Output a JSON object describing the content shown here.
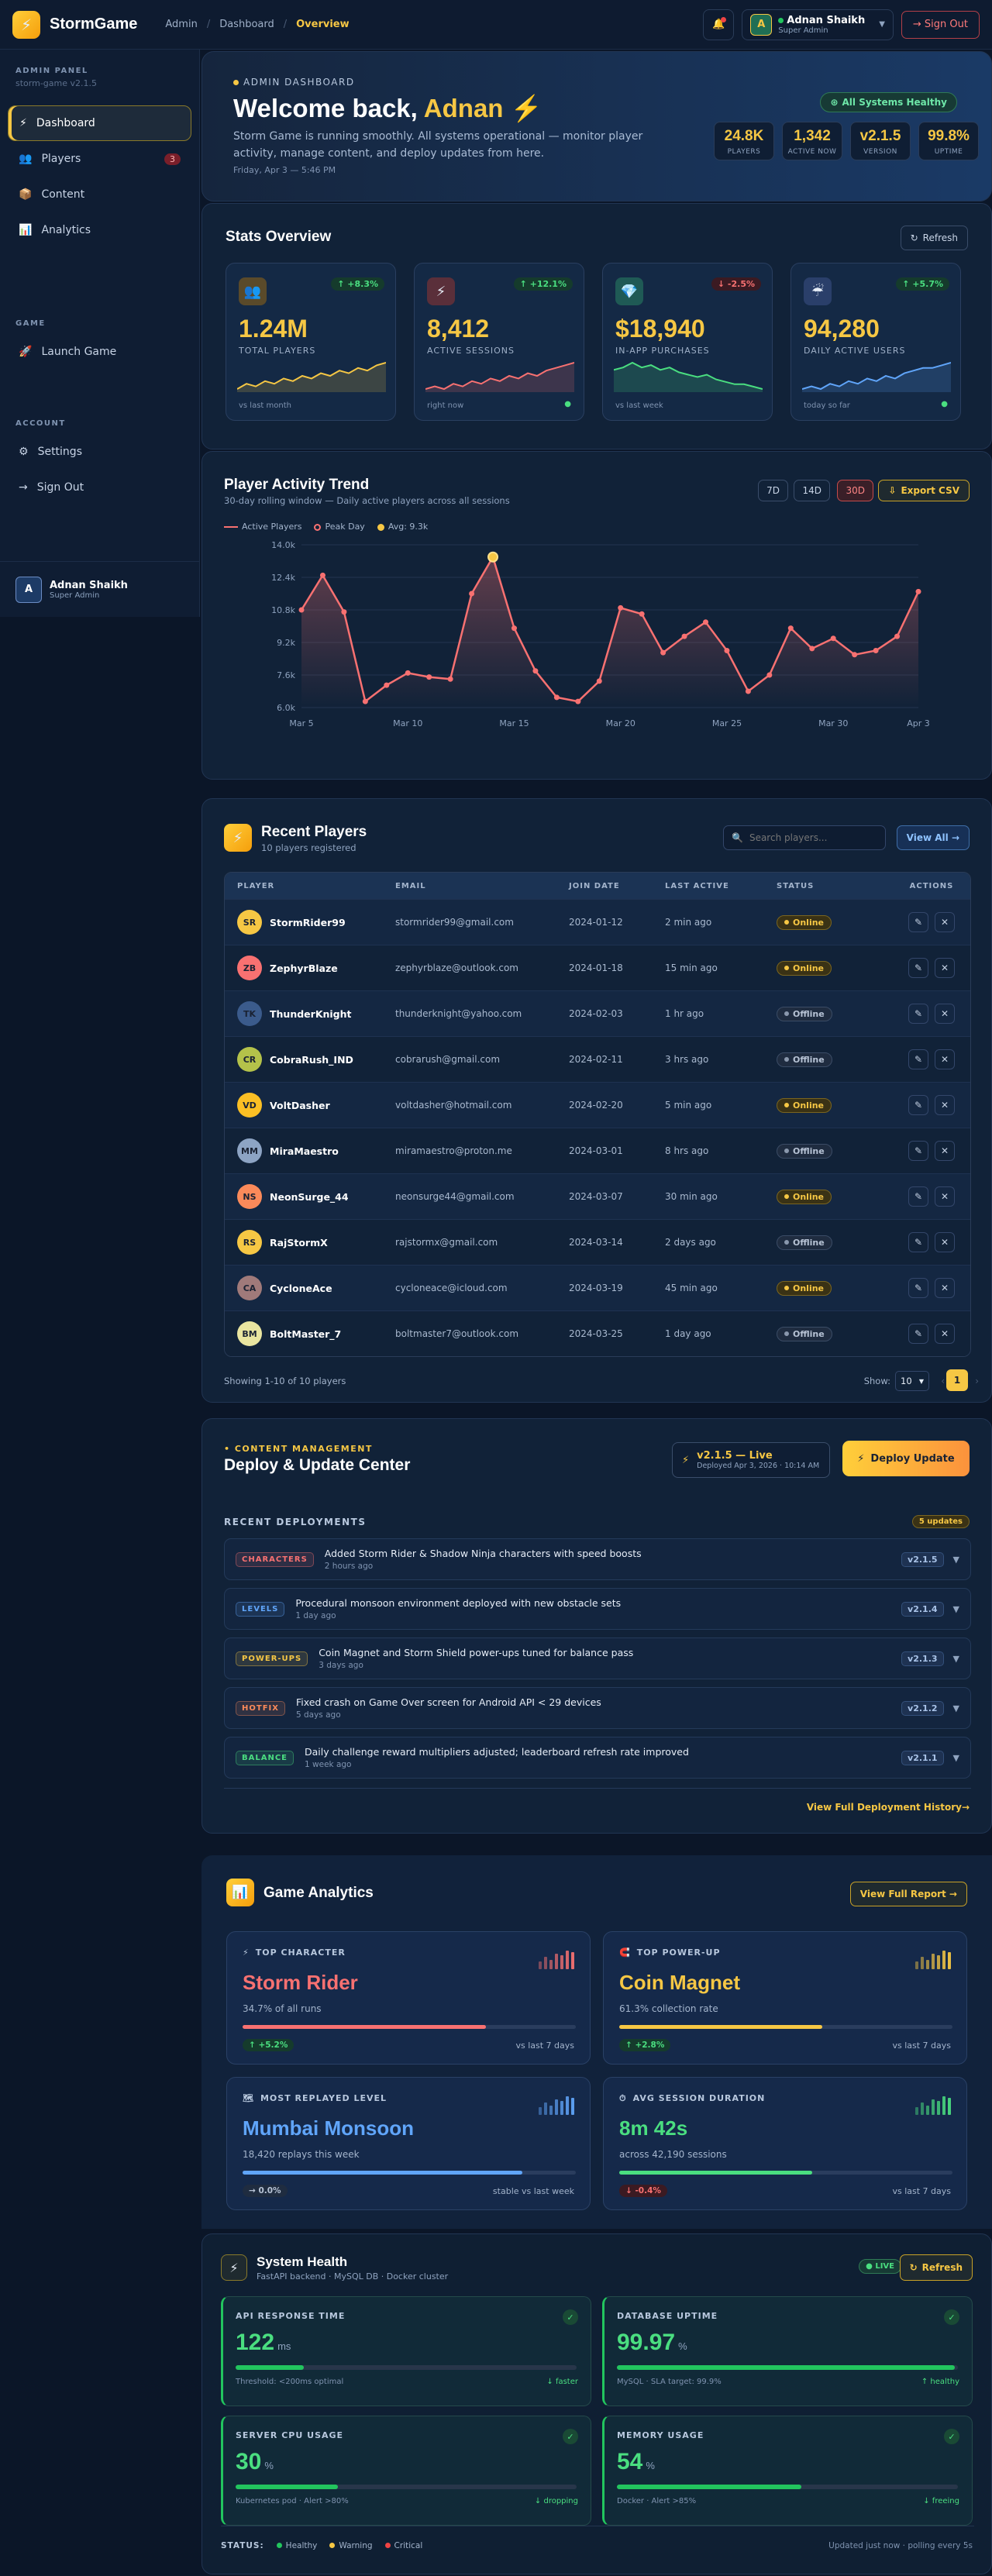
{
  "app": {
    "name": "StormGame"
  },
  "breadcrumb": [
    "Admin",
    "Dashboard",
    "Overview"
  ],
  "user": {
    "name": "Adnan Shaikh",
    "role": "Super Admin",
    "initial": "A"
  },
  "topbar": {
    "signout": "→ Sign Out"
  },
  "sidebar": {
    "heading": "ADMIN PANEL",
    "version": "storm-game v2.1.5",
    "items": [
      {
        "label": "Dashboard",
        "icon": "⚡"
      },
      {
        "label": "Players",
        "icon": "👥",
        "badge": "3"
      },
      {
        "label": "Content",
        "icon": "📦"
      },
      {
        "label": "Analytics",
        "icon": "📊"
      }
    ],
    "game_heading": "GAME",
    "game_items": [
      {
        "label": "Launch Game",
        "icon": "🚀"
      }
    ],
    "account_heading": "ACCOUNT",
    "account_items": [
      {
        "label": "Settings",
        "icon": "⚙"
      },
      {
        "label": "Sign Out",
        "icon": "→"
      }
    ]
  },
  "hero": {
    "tag": "ADMIN DASHBOARD",
    "welcome": "Welcome back,",
    "name": "Adnan ⚡",
    "desc": "Storm Game is running smoothly. All systems operational — monitor player activity, manage content, and deploy updates from here.",
    "date": "Friday, Apr 3 — 5:46 PM",
    "healthy": "All Systems Healthy",
    "pills": [
      {
        "value": "24.8K",
        "label": "PLAYERS"
      },
      {
        "value": "1,342",
        "label": "ACTIVE NOW"
      },
      {
        "value": "v2.1.5",
        "label": "VERSION"
      },
      {
        "value": "99.8%",
        "label": "UPTIME"
      }
    ]
  },
  "stats": {
    "title": "Stats Overview",
    "refresh": "Refresh",
    "cards": [
      {
        "icon": "👥",
        "change": "↑ +8.3%",
        "value": "1.24M",
        "label": "TOTAL PLAYERS",
        "caption": "vs last month",
        "color": "#f6c744",
        "trend": [
          6,
          8,
          7,
          9,
          8,
          10,
          9,
          11,
          10,
          12,
          11,
          13,
          12,
          14,
          13,
          15,
          16
        ]
      },
      {
        "icon": "⚡",
        "change": "↑ +12.1%",
        "value": "8,412",
        "label": "ACTIVE SESSIONS",
        "caption": "right now",
        "color": "#f87171",
        "trend": [
          5,
          6,
          5,
          7,
          6,
          8,
          7,
          9,
          8,
          10,
          9,
          11,
          10,
          12,
          13,
          14,
          15
        ]
      },
      {
        "icon": "💎",
        "change": "↓ -2.5%",
        "value": "$18,940",
        "label": "IN-APP PURCHASES",
        "caption": "vs last week",
        "color": "#4ade80",
        "trend": [
          12,
          13,
          15,
          13,
          14,
          12,
          13,
          11,
          10,
          9,
          10,
          8,
          7,
          6,
          6,
          5,
          4
        ]
      },
      {
        "icon": "☔",
        "change": "↑ +5.7%",
        "value": "94,280",
        "label": "DAILY ACTIVE USERS",
        "caption": "today so far",
        "color": "#60a5fa",
        "trend": [
          4,
          5,
          4,
          6,
          5,
          7,
          6,
          8,
          7,
          9,
          8,
          10,
          11,
          12,
          12,
          13,
          14
        ]
      }
    ]
  },
  "activity": {
    "title": "Player Activity Trend",
    "subtitle": "30-day rolling window — Daily active players across all sessions",
    "ranges": [
      "7D",
      "14D",
      "30D"
    ],
    "export": "Export CSV",
    "legend": [
      "Active Players",
      "Peak Day",
      "Avg: 9.3k"
    ]
  },
  "chart_data": {
    "type": "line",
    "x": [
      "Mar 5",
      "Mar 6",
      "Mar 7",
      "Mar 8",
      "Mar 9",
      "Mar 10",
      "Mar 11",
      "Mar 12",
      "Mar 13",
      "Mar 14",
      "Mar 15",
      "Mar 16",
      "Mar 17",
      "Mar 18",
      "Mar 19",
      "Mar 20",
      "Mar 21",
      "Mar 22",
      "Mar 23",
      "Mar 24",
      "Mar 25",
      "Mar 26",
      "Mar 27",
      "Mar 28",
      "Mar 29",
      "Mar 30",
      "Mar 31",
      "Apr 1",
      "Apr 2",
      "Apr 3"
    ],
    "series": [
      {
        "name": "Active Players",
        "values": [
          10.8,
          12.5,
          10.7,
          6.3,
          7.1,
          7.7,
          7.5,
          7.4,
          11.6,
          13.4,
          9.9,
          7.8,
          6.5,
          6.3,
          7.3,
          10.9,
          10.6,
          8.7,
          9.5,
          10.2,
          8.8,
          6.8,
          7.6,
          9.9,
          8.9,
          9.4,
          8.6,
          8.8,
          9.5,
          11.7
        ]
      }
    ],
    "peak_index": 9,
    "x_ticks": [
      "Mar 5",
      "Mar 10",
      "Mar 15",
      "Mar 20",
      "Mar 25",
      "Mar 30",
      "Apr 3"
    ],
    "y_ticks": [
      "6.0k",
      "7.6k",
      "9.2k",
      "10.8k",
      "12.4k",
      "14.0k"
    ],
    "ylim": [
      6.0,
      14.0
    ],
    "grid": true,
    "legend_position": "top-left"
  },
  "players": {
    "title": "Recent Players",
    "subtitle": "10 players registered",
    "search_placeholder": "Search players...",
    "view_all": "View All →",
    "columns": [
      "PLAYER",
      "EMAIL",
      "JOIN DATE",
      "LAST ACTIVE",
      "STATUS",
      "ACTIONS"
    ],
    "rows": [
      {
        "initials": "SR",
        "name": "StormRider99",
        "email": "stormrider99@gmail.com",
        "join": "2024-01-12",
        "last": "2 min ago",
        "status": "Online",
        "color": "#f6c744"
      },
      {
        "initials": "ZB",
        "name": "ZephyrBlaze",
        "email": "zephyrblaze@outlook.com",
        "join": "2024-01-18",
        "last": "15 min ago",
        "status": "Online",
        "color": "#f87171"
      },
      {
        "initials": "TK",
        "name": "ThunderKnight",
        "email": "thunderknight@yahoo.com",
        "join": "2024-02-03",
        "last": "1 hr ago",
        "status": "Offline",
        "color": "#3b5b8c"
      },
      {
        "initials": "CR",
        "name": "CobraRush_IND",
        "email": "cobrarush@gmail.com",
        "join": "2024-02-11",
        "last": "3 hrs ago",
        "status": "Offline",
        "color": "#b4c24a"
      },
      {
        "initials": "VD",
        "name": "VoltDasher",
        "email": "voltdasher@hotmail.com",
        "join": "2024-02-20",
        "last": "5 min ago",
        "status": "Online",
        "color": "#fbbf24"
      },
      {
        "initials": "MM",
        "name": "MiraMaestro",
        "email": "miramaestro@proton.me",
        "join": "2024-03-01",
        "last": "8 hrs ago",
        "status": "Offline",
        "color": "#8da4c4"
      },
      {
        "initials": "NS",
        "name": "NeonSurge_44",
        "email": "neonsurge44@gmail.com",
        "join": "2024-03-07",
        "last": "30 min ago",
        "status": "Online",
        "color": "#fb8a5a"
      },
      {
        "initials": "RS",
        "name": "RajStormX",
        "email": "rajstormx@gmail.com",
        "join": "2024-03-14",
        "last": "2 days ago",
        "status": "Offline",
        "color": "#f6c744"
      },
      {
        "initials": "CA",
        "name": "CycloneAce",
        "email": "cycloneace@icloud.com",
        "join": "2024-03-19",
        "last": "45 min ago",
        "status": "Online",
        "color": "#a07a7a"
      },
      {
        "initials": "BM",
        "name": "BoltMaster_7",
        "email": "boltmaster7@outlook.com",
        "join": "2024-03-25",
        "last": "1 day ago",
        "status": "Offline",
        "color": "#e9e5a0"
      }
    ],
    "showing": "Showing 1-10 of 10 players",
    "show_label": "Show:",
    "page_size": "10",
    "page": "1"
  },
  "deploy": {
    "tag": "• CONTENT MANAGEMENT",
    "title": "Deploy & Update Center",
    "live": "v2.1.5 — Live",
    "live_sub": "Deployed Apr 3, 2026 · 10:14 AM",
    "deploy_btn": "Deploy Update",
    "recent": "RECENT DEPLOYMENTS",
    "count": "5 updates",
    "items": [
      {
        "tag": "CHARACTERS",
        "title": "Added Storm Rider & Shadow Ninja characters with speed boosts",
        "time": "2 hours ago",
        "ver": "v2.1.5",
        "color": "#f87171"
      },
      {
        "tag": "LEVELS",
        "title": "Procedural monsoon environment deployed with new obstacle sets",
        "time": "1 day ago",
        "ver": "v2.1.4",
        "color": "#60a5fa"
      },
      {
        "tag": "POWER-UPS",
        "title": "Coin Magnet and Storm Shield power-ups tuned for balance pass",
        "time": "3 days ago",
        "ver": "v2.1.3",
        "color": "#f6c744"
      },
      {
        "tag": "HOTFIX",
        "title": "Fixed crash on Game Over screen for Android API < 29 devices",
        "time": "5 days ago",
        "ver": "v2.1.2",
        "color": "#fb8a5a"
      },
      {
        "tag": "BALANCE",
        "title": "Daily challenge reward multipliers adjusted; leaderboard refresh rate improved",
        "time": "1 week ago",
        "ver": "v2.1.1",
        "color": "#4ade80"
      }
    ],
    "history": "View Full Deployment History→"
  },
  "analytics": {
    "title": "Game Analytics",
    "report": "View Full Report →",
    "cards": [
      {
        "icon": "⚡",
        "head": "TOP CHARACTER",
        "value": "Storm Rider",
        "sub": "34.7% of all runs",
        "change": "↑ +5.2%",
        "range": "vs last 7 days",
        "color": "#f87171",
        "fill": 0.73
      },
      {
        "icon": "🧲",
        "head": "TOP POWER-UP",
        "value": "Coin Magnet",
        "sub": "61.3% collection rate",
        "change": "↑ +2.8%",
        "range": "vs last 7 days",
        "color": "#f6c744",
        "fill": 0.61
      },
      {
        "icon": "🗺",
        "head": "MOST REPLAYED LEVEL",
        "value": "Mumbai Monsoon",
        "sub": "18,420 replays this week",
        "change": "→ 0.0%",
        "range": "stable vs last week",
        "color": "#60a5fa",
        "fill": 0.84
      },
      {
        "icon": "⏱",
        "head": "AVG SESSION DURATION",
        "value": "8m 42s",
        "sub": "across 42,190 sessions",
        "change": "↓ -0.4%",
        "range": "vs last 7 days",
        "color": "#4ade80",
        "fill": 0.58
      }
    ]
  },
  "health": {
    "title": "System Health",
    "subtitle": "FastAPI backend · MySQL DB · Docker cluster",
    "live": "● LIVE",
    "refresh": "Refresh",
    "cards": [
      {
        "head": "API RESPONSE TIME",
        "value": "122",
        "unit": "ms",
        "note": "Threshold: <200ms optimal",
        "trend": "↓ faster",
        "fill": 0.2
      },
      {
        "head": "DATABASE UPTIME",
        "value": "99.97",
        "unit": "%",
        "note": "MySQL · SLA target: 99.9%",
        "trend": "↑ healthy",
        "fill": 0.99
      },
      {
        "head": "SERVER CPU USAGE",
        "value": "30",
        "unit": "%",
        "note": "Kubernetes pod · Alert >80%",
        "trend": "↓ dropping",
        "fill": 0.3
      },
      {
        "head": "MEMORY USAGE",
        "value": "54",
        "unit": "%",
        "note": "Docker · Alert >85%",
        "trend": "↓ freeing",
        "fill": 0.54
      }
    ],
    "status_label": "STATUS:",
    "legend": [
      "Healthy",
      "Warning",
      "Critical"
    ],
    "updated": "Updated just now · polling every 5s"
  }
}
